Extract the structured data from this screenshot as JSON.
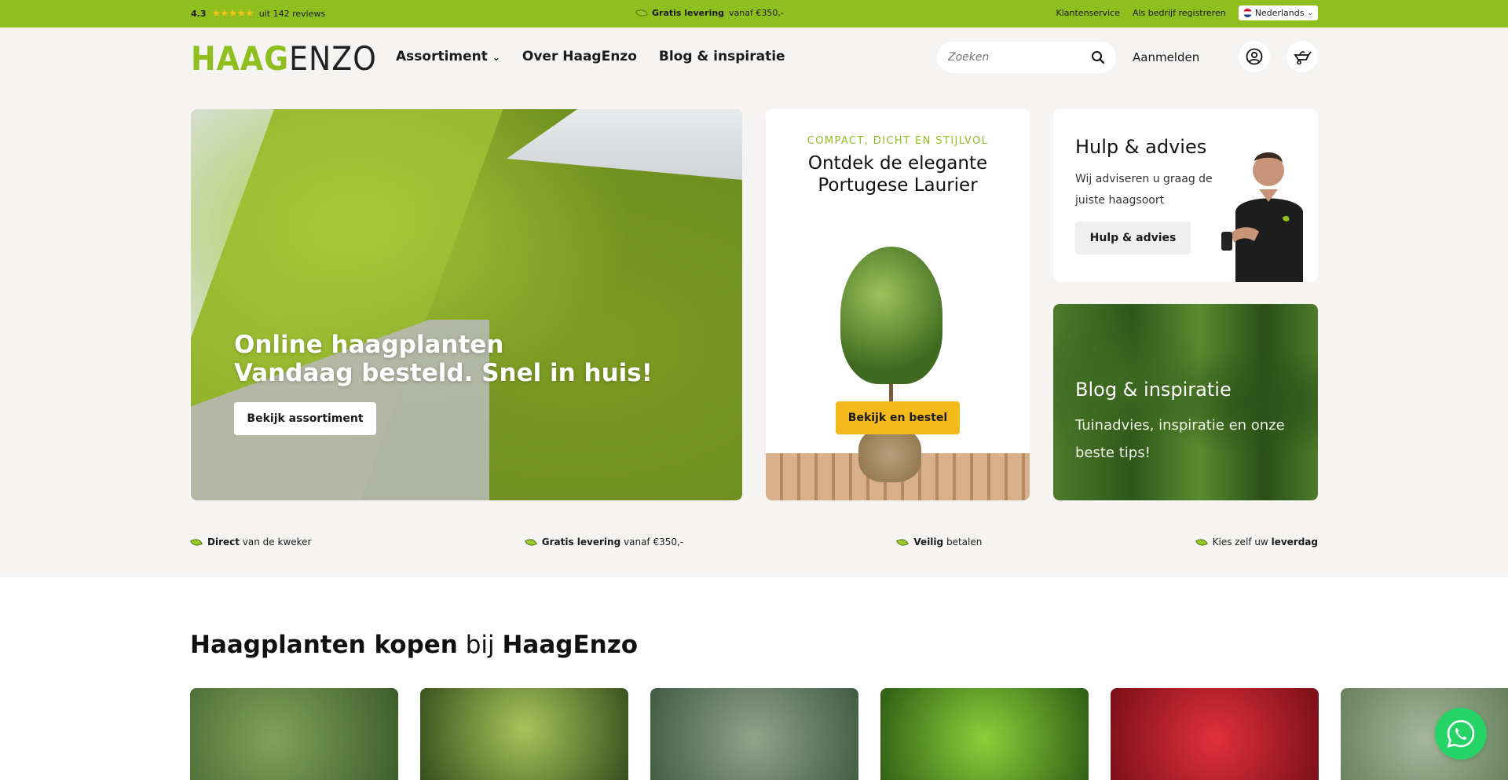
{
  "topbar": {
    "rating_score": "4.3",
    "rating_stars": "★★★★★",
    "rating_reviews": "uit 142 reviews",
    "promo_bold": "Gratis levering",
    "promo_rest": "vanaf €350,-",
    "links": [
      "Klantenservice",
      "Als bedrijf registreren"
    ],
    "language": "Nederlands"
  },
  "header": {
    "logo_part1": "HAAG",
    "logo_part2": "ENZO",
    "nav": [
      "Assortiment",
      "Over HaagEnzo",
      "Blog & inspiratie"
    ],
    "search_placeholder": "Zoeken",
    "login_label": "Aanmelden"
  },
  "hero": {
    "title_line1": "Online haagplanten",
    "title_line2": "Vandaag besteld. Snel in huis!",
    "button": "Bekijk assortiment"
  },
  "laurier": {
    "kicker": "COMPACT, DICHT EN STIJLVOL",
    "title_line1": "Ontdek de elegante",
    "title_line2": "Portugese Laurier",
    "button": "Bekijk en bestel"
  },
  "hulp": {
    "title": "Hulp & advies",
    "text": "Wij adviseren u graag de juiste haagsoort",
    "button": "Hulp & advies"
  },
  "blog": {
    "title": "Blog & inspiratie",
    "text": "Tuinadvies, inspiratie en onze beste tips!"
  },
  "usps": [
    {
      "bold": "Direct",
      "rest": " van de kweker"
    },
    {
      "bold": "Gratis levering",
      "rest": " vanaf €350,-"
    },
    {
      "bold": "Veilig",
      "rest": " betalen"
    },
    {
      "pre": "Kies zelf uw ",
      "bold": "leverdag"
    }
  ],
  "section": {
    "title_bold1": "Haagplanten kopen",
    "title_mid": " bij ",
    "title_bold2": "HaagEnzo"
  },
  "colors": {
    "brand_green": "#8fbe1f",
    "accent_yellow": "#f4b91a",
    "whatsapp_green": "#25d366"
  }
}
